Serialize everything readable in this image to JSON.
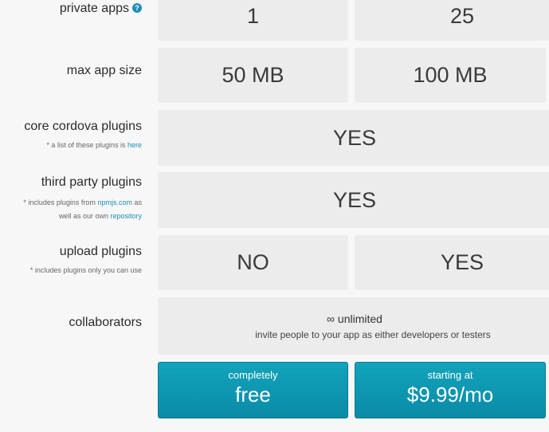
{
  "rows": {
    "private_apps": {
      "label": "private apps",
      "help_icon": "?",
      "free": "1",
      "paid": "25"
    },
    "max_app_size": {
      "label": "max app size",
      "free": "50 MB",
      "paid": "100 MB"
    },
    "core_plugins": {
      "label": "core cordova plugins",
      "note_prefix": "* a list of these plugins is",
      "note_link": "here",
      "value": "YES"
    },
    "third_party": {
      "label": "third party plugins",
      "note_prefix": "* includes plugins from",
      "note_link1": "npmjs.com",
      "note_mid1": "as",
      "note_mid2": "well as our own",
      "note_link2": "repository",
      "value": "YES"
    },
    "upload": {
      "label": "upload plugins",
      "note": "* includes plugins only you can use",
      "free": "NO",
      "paid": "YES"
    },
    "collaborators": {
      "label": "collaborators",
      "value": "∞ unlimited",
      "sub": "invite people to your app as either developers or testers"
    }
  },
  "pricing": {
    "free": {
      "top": "completely",
      "main": "free"
    },
    "paid": {
      "top": "starting at",
      "main": "$9.99/mo"
    }
  },
  "colors": {
    "accent": "#0a8ba6",
    "link": "#1b8fb2"
  }
}
